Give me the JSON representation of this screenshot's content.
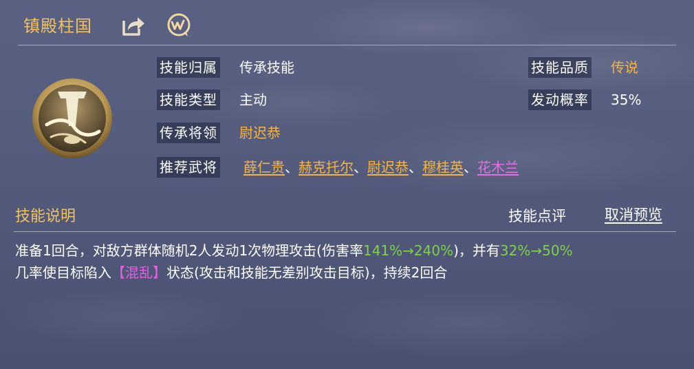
{
  "skill": {
    "name": "镇殿柱国",
    "belong_label": "技能归属",
    "belong_value": "传承技能",
    "type_label": "技能类型",
    "type_value": "主动",
    "general_label": "传承将领",
    "general_value": "尉迟恭",
    "recommend_label": "推荐武将",
    "recommend": [
      "薛仁贵",
      "赫克托尔",
      "尉迟恭",
      "穆桂英",
      "花木兰"
    ],
    "separator": "、",
    "quality_label": "技能品质",
    "quality_value": "传说",
    "chance_label": "发动概率",
    "chance_value": "35%"
  },
  "description": {
    "title": "技能说明",
    "review_label": "技能点评",
    "cancel_preview_label": "取消预览",
    "line1_a": "准备1回合，对敌方群体随机2人发动1次物理攻击(伤害率",
    "line1_b": "141%→240%",
    "line1_c": ")，并有",
    "line1_d": "32%→50%",
    "line2_a": "几率使目标陷入",
    "line2_b": "【混乱】",
    "line2_c": "状态(攻击和技能无差别攻击目标)，持续2回合"
  },
  "colors": {
    "title_gold": "#f3c25a",
    "value_gold": "#f3b646",
    "purple": "#e56ee6",
    "green": "#7fd14a"
  },
  "icons": [
    "share-icon",
    "chat-icon",
    "skill-emblem-icon"
  ]
}
